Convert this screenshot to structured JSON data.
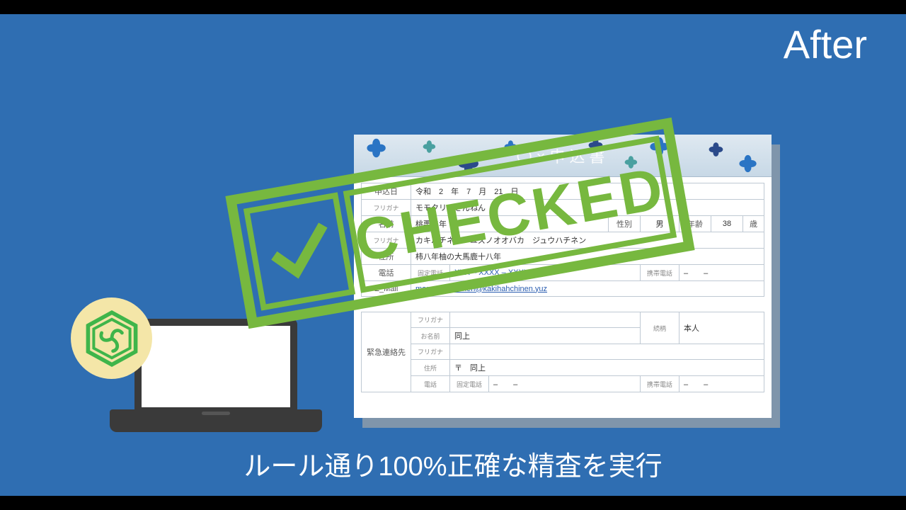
{
  "title": "After",
  "caption": "ルール通り100%正確な精査を実行",
  "stamp": "CHECKED",
  "form": {
    "header_title": "〇×申込書",
    "date": {
      "label": "申込日",
      "era": "令和",
      "year": "2",
      "y_suf": "年",
      "month": "7",
      "m_suf": "月",
      "day": "21",
      "d_suf": "日"
    },
    "furigana_label": "フリガナ",
    "name_furigana": "モモクリ　さんねん",
    "name_label": "名前",
    "name_value": "桃栗三年",
    "gender_label": "性別",
    "gender_value": "男",
    "age_label": "年齢",
    "age_value": "38",
    "age_suffix": "歳",
    "addr_furigana": "カキハチネン　ユズノオオバカ　ジュウハチネン",
    "addr_label": "住所",
    "addr_value": "柿八年柚の大馬鹿十八年",
    "tel_label": "電話",
    "landline_label": "固定電話",
    "landline_value": "XXX – XXXX – XXXX",
    "mobile_label": "携帯電話",
    "mobile_value": "–　　–",
    "email_label": "E_Mail",
    "email_value": "momokurisannen@kakihahchinen.yuz",
    "emergency": {
      "section_label": "緊急連絡先",
      "furigana_label": "フリガナ",
      "name_label": "お名前",
      "name_value": "同上",
      "relation_label": "続柄",
      "relation_value": "本人",
      "addr_label": "住所",
      "addr_prefix": "〒",
      "addr_value": "同上",
      "tel_label": "電話",
      "landline_label": "固定電話",
      "landline_value": "–　　–",
      "mobile_label": "携帯電話",
      "mobile_value": "–　　–"
    }
  }
}
